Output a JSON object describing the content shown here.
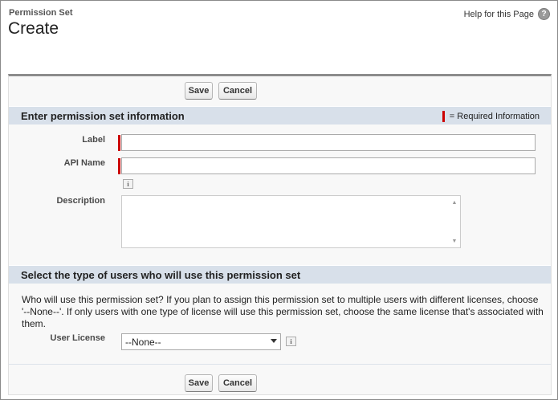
{
  "header": {
    "breadcrumb": "Permission Set",
    "title": "Create",
    "help_link": "Help for this Page",
    "help_icon": "help-icon"
  },
  "buttons": {
    "save": "Save",
    "cancel": "Cancel"
  },
  "section1": {
    "title": "Enter permission set information",
    "required_legend": "= Required Information",
    "fields": {
      "label": {
        "label": "Label",
        "value": ""
      },
      "api_name": {
        "label": "API Name",
        "value": "",
        "info_icon": "i"
      },
      "description": {
        "label": "Description",
        "value": ""
      }
    }
  },
  "section2": {
    "title": "Select the type of users who will use this permission set",
    "instructions": "Who will use this permission set? If you plan to assign this permission set to multiple users with different licenses, choose '--None--'. If only users with one type of license will use this permission set, choose the same license that's associated with them.",
    "user_license": {
      "label": "User License",
      "selected": "--None--",
      "info_icon": "i"
    }
  },
  "colors": {
    "required": "#cc0000",
    "section_header_bg": "#d8e0ea",
    "panel_bg": "#f8f8f8"
  }
}
